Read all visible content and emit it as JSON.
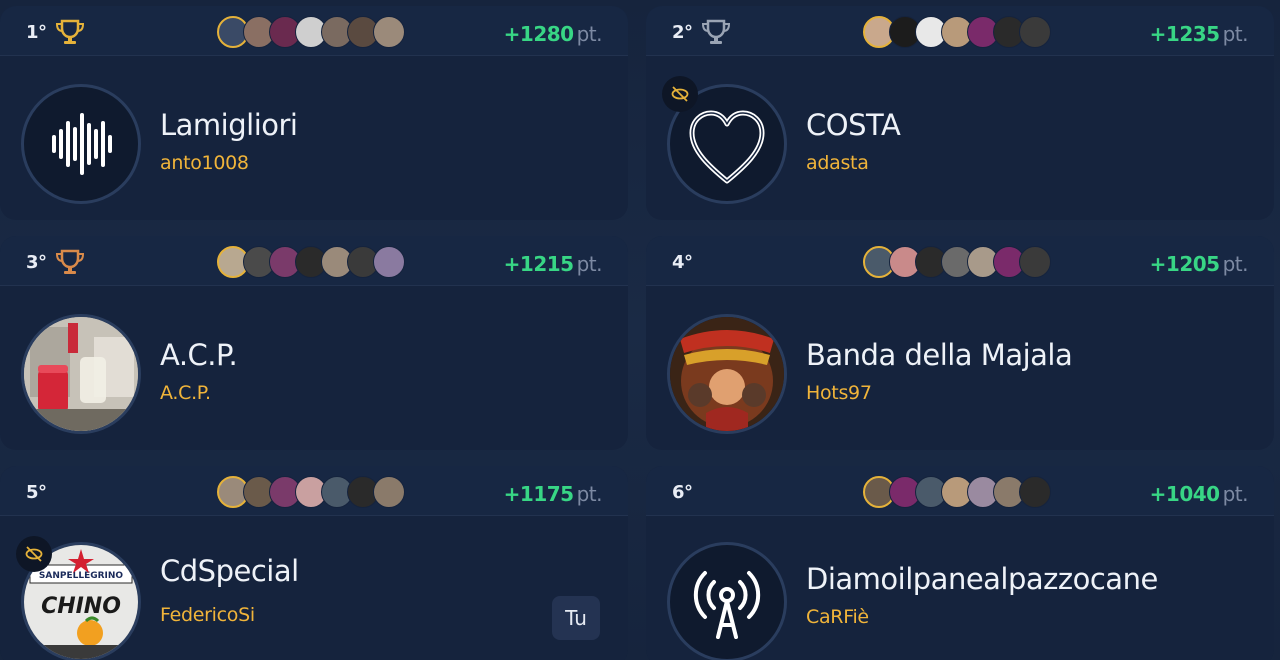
{
  "leaderboard": [
    {
      "rank": "1°",
      "trophy_color": "#e5b23a",
      "points": "+1280",
      "points_unit": "pt.",
      "team_name": "Lamigliori",
      "owner": "anto1008",
      "logo_icon": "sound-wave-icon",
      "hidden": false,
      "avatar_colors": [
        "#3a4a66",
        "#8a6f63",
        "#6a2a4f",
        "#cfcfcf",
        "#7a6a60",
        "#5a4a40",
        "#9b8a7a"
      ]
    },
    {
      "rank": "2°",
      "trophy_color": "#9aa4b4",
      "points": "+1235",
      "points_unit": "pt.",
      "team_name": "COSTA",
      "owner": "adasta",
      "logo_icon": "heart-icon",
      "hidden": true,
      "avatar_colors": [
        "#c9a88c",
        "#1c1c1c",
        "#e8e8e8",
        "#b89a7a",
        "#7a2a6a",
        "#2a2a2a",
        "#3a3a3a"
      ]
    },
    {
      "rank": "3°",
      "trophy_color": "#d98a4a",
      "points": "+1215",
      "points_unit": "pt.",
      "team_name": "A.C.P.",
      "owner": "A.C.P.",
      "logo_icon": "photo-drink-icon",
      "hidden": false,
      "avatar_colors": [
        "#b8a890",
        "#4a4a4a",
        "#7a3a6a",
        "#2a2a2a",
        "#9a8a7a",
        "#3a3a3a",
        "#8a7aa0"
      ]
    },
    {
      "rank": "4°",
      "trophy_color": "",
      "points": "+1205",
      "points_unit": "pt.",
      "team_name": "Banda della Majala",
      "owner": "Hots97",
      "logo_icon": "banda-illustration-icon",
      "hidden": false,
      "avatar_colors": [
        "#4a5a6a",
        "#c98a8a",
        "#2a2a2a",
        "#6a6a6a",
        "#a89a8a",
        "#7a2a6a",
        "#3a3a3a"
      ]
    },
    {
      "rank": "5°",
      "trophy_color": "",
      "points": "+1175",
      "points_unit": "pt.",
      "team_name": "CdSpecial",
      "owner": "FedericoSi",
      "logo_icon": "sanpellegrino-chino-icon",
      "hidden": true,
      "is_you": true,
      "you_label": "Tu",
      "avatar_colors": [
        "#9a8a7a",
        "#6a5a4a",
        "#7a3a6a",
        "#c9a0a0",
        "#4a5a6a",
        "#2a2a2a",
        "#8a7a6a"
      ]
    },
    {
      "rank": "6°",
      "trophy_color": "",
      "points": "+1040",
      "points_unit": "pt.",
      "team_name": "Diamoilpanealpazzocane",
      "owner": "CaRFiè",
      "logo_icon": "broadcast-tower-icon",
      "hidden": false,
      "avatar_colors": [
        "#6a5a4a",
        "#7a2a6a",
        "#4a5a6a",
        "#b89a7a",
        "#9a8aa0",
        "#8a7a6a",
        "#2a2a2a"
      ]
    }
  ]
}
